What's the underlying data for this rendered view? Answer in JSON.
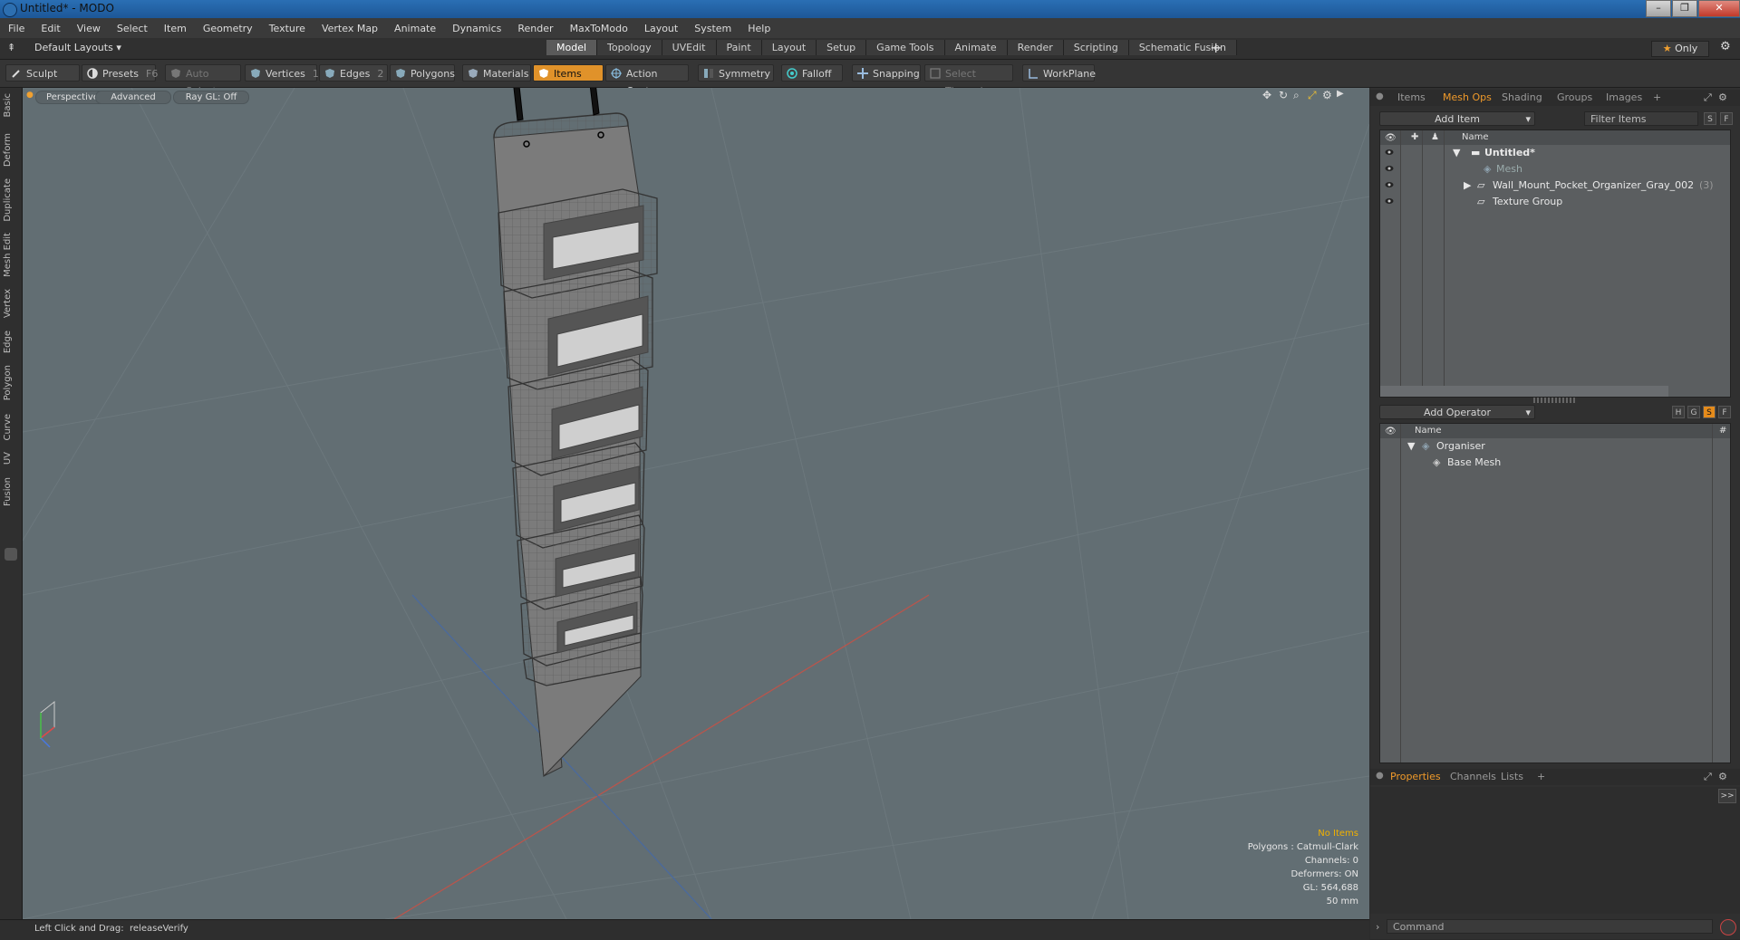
{
  "window": {
    "title": "Untitled* - MODO"
  },
  "menu": [
    "File",
    "Edit",
    "View",
    "Select",
    "Item",
    "Geometry",
    "Texture",
    "Vertex Map",
    "Animate",
    "Dynamics",
    "Render",
    "MaxToModo",
    "Layout",
    "System",
    "Help"
  ],
  "layout_bar": {
    "layouts_label": "Default Layouts",
    "tabs": [
      "Model",
      "Topology",
      "UVEdit",
      "Paint",
      "Layout",
      "Setup",
      "Game Tools",
      "Animate",
      "Render",
      "Scripting",
      "Schematic Fusion"
    ],
    "active_tab": "Model",
    "plus": "+",
    "only_label": "Only",
    "star": "★"
  },
  "toolbar": {
    "sculpt": "Sculpt",
    "presets": "Presets",
    "presets_key": "F6",
    "auto_select": "Auto Select",
    "vertices": "Vertices",
    "vertices_key": "1",
    "edges": "Edges",
    "edges_key": "2",
    "polygons": "Polygons",
    "materials": "Materials",
    "items": "Items",
    "action_center": "Action Center",
    "symmetry": "Symmetry",
    "falloff": "Falloff",
    "snapping": "Snapping",
    "select_through": "Select Through",
    "workplane": "WorkPlane"
  },
  "left_tabs": [
    "Basic",
    "Deform",
    "Duplicate",
    "Mesh Edit",
    "Vertex",
    "Edge",
    "Polygon",
    "Curve",
    "UV",
    "Fusion"
  ],
  "viewport": {
    "perspective": "Perspective",
    "advanced": "Advanced",
    "raygl": "Ray GL: Off",
    "stats": {
      "no_items": "No Items",
      "polygons": "Polygons : Catmull-Clark",
      "channels": "Channels: 0",
      "deformers": "Deformers: ON",
      "gl": "GL: 564,688",
      "scale": "50 mm"
    }
  },
  "status": {
    "hint_label": "Left Click and Drag:",
    "hint_value": "releaseVerify"
  },
  "items_panel": {
    "tabs": [
      "Items",
      "Mesh Ops",
      "Shading",
      "Groups",
      "Images"
    ],
    "active_tab": "Mesh Ops",
    "add_item": "Add Item",
    "filter": "Filter Items",
    "s": "S",
    "f": "F",
    "col_name": "Name",
    "rows": [
      {
        "name": "Untitled*",
        "extra": ""
      },
      {
        "name": "Mesh",
        "extra": ""
      },
      {
        "name": "Wall_Mount_Pocket_Organizer_Gray_002",
        "extra": "(3)"
      },
      {
        "name": "Texture Group",
        "extra": ""
      }
    ]
  },
  "meshops_panel": {
    "add_operator": "Add Operator",
    "h": "H",
    "g": "G",
    "s": "S",
    "f": "F",
    "col_name": "Name",
    "col_hash": "#",
    "rows": [
      {
        "name": "Organiser"
      },
      {
        "name": "Base Mesh"
      }
    ]
  },
  "properties_panel": {
    "tabs": [
      "Properties",
      "Channels",
      "Lists"
    ],
    "active_tab": "Properties",
    "expand": ">>",
    "command_placeholder": "Command"
  },
  "colors": {
    "accent": "#e0922a",
    "viewport_bg": "#626e73",
    "panel_bg": "#303030"
  }
}
